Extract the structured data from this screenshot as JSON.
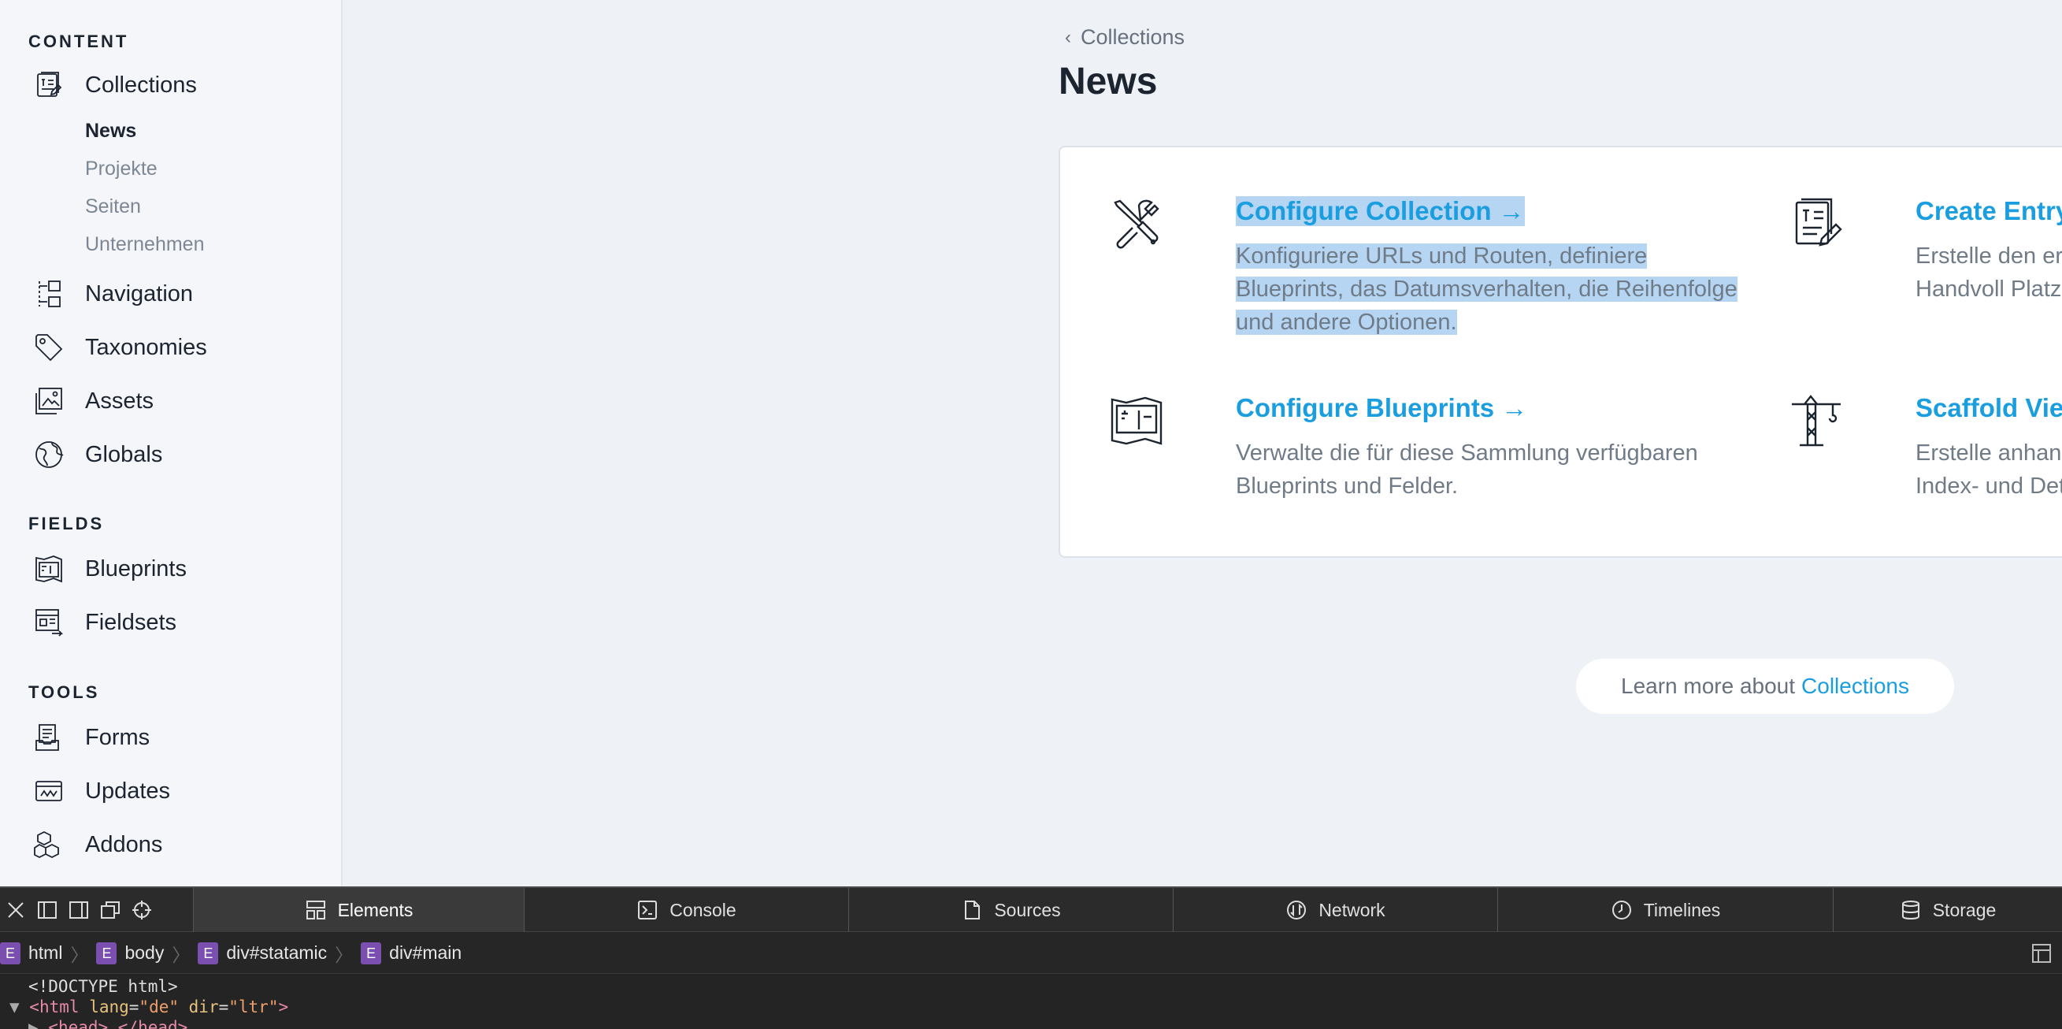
{
  "sidebar": {
    "content_heading": "CONTENT",
    "collections_label": "Collections",
    "collection_items": [
      "News",
      "Projekte",
      "Seiten",
      "Unternehmen"
    ],
    "navigation_label": "Navigation",
    "taxonomies_label": "Taxonomies",
    "assets_label": "Assets",
    "globals_label": "Globals",
    "fields_heading": "FIELDS",
    "blueprints_label": "Blueprints",
    "fieldsets_label": "Fieldsets",
    "tools_heading": "TOOLS",
    "forms_label": "Forms",
    "updates_label": "Updates",
    "addons_label": "Addons"
  },
  "main": {
    "breadcrumb": "Collections",
    "title": "News",
    "options": [
      {
        "title": "Configure Collection →",
        "desc": "Konfiguriere URLs und Routen, definiere Blueprints, das Datumsverhalten, die Reihenfolge und andere Optionen."
      },
      {
        "title": "Create Entry →",
        "desc": "Erstelle den ersten Handvoll Platzhalte"
      },
      {
        "title": "Configure Blueprints →",
        "desc": "Verwalte die für diese Sammlung verfügbaren Blueprints und Felder."
      },
      {
        "title": "Scaffold Views →",
        "desc": "Erstelle anhand des Index- und Detailan"
      }
    ],
    "learn_prefix": "Learn more about",
    "learn_link": "Collections"
  },
  "devtools": {
    "tabs": [
      "Elements",
      "Console",
      "Sources",
      "Network",
      "Timelines",
      "Storage"
    ],
    "breadcrumbs": [
      "html",
      "body",
      "div#statamic",
      "div#main"
    ],
    "code_doctype": "<!DOCTYPE html>",
    "code_html_tag": "html",
    "code_lang_attr": "lang",
    "code_lang_val": "\"de\"",
    "code_dir_attr": "dir",
    "code_dir_val": "\"ltr\"",
    "code_head": "<head>…</head>"
  },
  "colors": {
    "accent": "#1a9ee0",
    "highlight": "#b5d5f2",
    "background": "#eef1f6"
  }
}
